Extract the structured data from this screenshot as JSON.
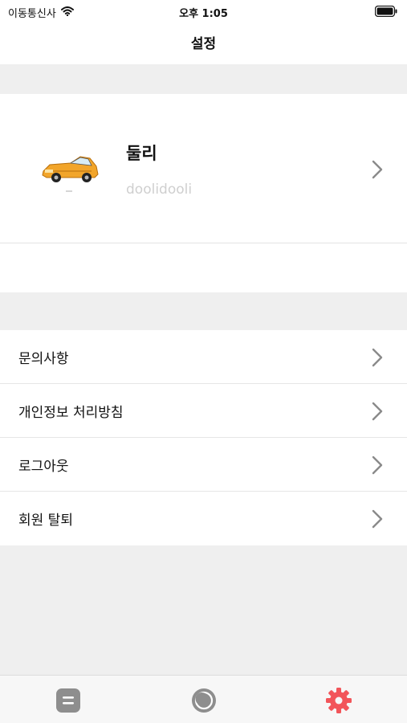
{
  "status_bar": {
    "carrier": "이동통신사",
    "time": "오후 1:05"
  },
  "nav": {
    "title": "설정"
  },
  "profile": {
    "name": "둘리",
    "id": "doolidooli"
  },
  "menu": {
    "items": [
      {
        "label": "문의사항"
      },
      {
        "label": "개인정보 처리방침"
      },
      {
        "label": "로그아웃"
      },
      {
        "label": "회원 탈퇴"
      }
    ]
  },
  "tab_bar": {
    "tabs": [
      {
        "icon": "list-icon"
      },
      {
        "icon": "circle-icon"
      },
      {
        "icon": "gear-icon"
      }
    ],
    "active_color": "#f2555a"
  },
  "colors": {
    "background": "#efefef",
    "chevron": "#8a8a8a",
    "id_text": "#cfcfcf"
  }
}
